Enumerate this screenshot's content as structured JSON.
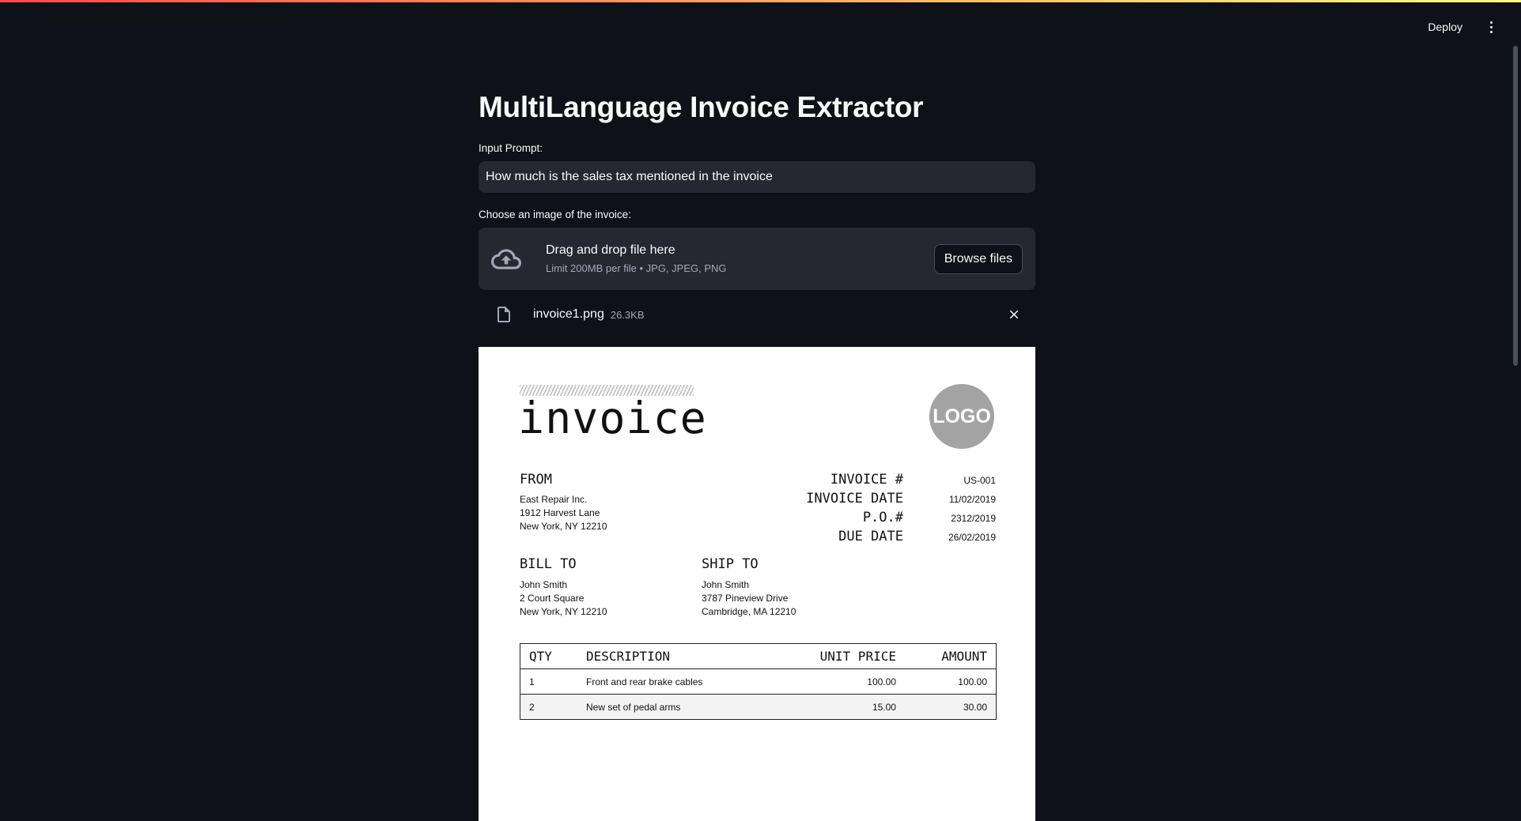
{
  "header": {
    "deploy_label": "Deploy"
  },
  "main": {
    "title": "MultiLanguage Invoice Extractor",
    "prompt_label": "Input Prompt:",
    "prompt_value": "How much is the sales tax mentioned in the invoice",
    "upload_label": "Choose an image of the invoice:",
    "dropzone_title": "Drag and drop file here",
    "dropzone_limit": "Limit 200MB per file • JPG, JPEG, PNG",
    "browse_label": "Browse files",
    "file_name": "invoice1.png",
    "file_size": "26.3KB"
  },
  "invoice": {
    "title": "invoice",
    "logo": "LOGO",
    "from_label": "FROM",
    "from_lines": [
      "East Repair Inc.",
      "1912 Harvest Lane",
      "New York, NY 12210"
    ],
    "meta": [
      {
        "label": "INVOICE #",
        "value": "US-001"
      },
      {
        "label": "INVOICE DATE",
        "value": "11/02/2019"
      },
      {
        "label": "P.O.#",
        "value": "2312/2019"
      },
      {
        "label": "DUE DATE",
        "value": "26/02/2019"
      }
    ],
    "bill_to_label": "BILL TO",
    "bill_to_lines": [
      "John Smith",
      "2 Court Square",
      "New York, NY 12210"
    ],
    "ship_to_label": "SHIP TO",
    "ship_to_lines": [
      "John Smith",
      "3787 Pineview Drive",
      "Cambridge, MA 12210"
    ],
    "columns": [
      "QTY",
      "DESCRIPTION",
      "UNIT PRICE",
      "AMOUNT"
    ],
    "rows": [
      [
        "1",
        "Front and rear brake cables",
        "100.00",
        "100.00"
      ],
      [
        "2",
        "New set of pedal arms",
        "15.00",
        "30.00"
      ]
    ]
  },
  "colors": {
    "background": "#0e1117",
    "input_bg": "#262730",
    "accent": "#ff4b4b"
  },
  "icons": [
    "cloud-upload-icon",
    "file-icon",
    "close-icon",
    "more-vertical-icon"
  ]
}
